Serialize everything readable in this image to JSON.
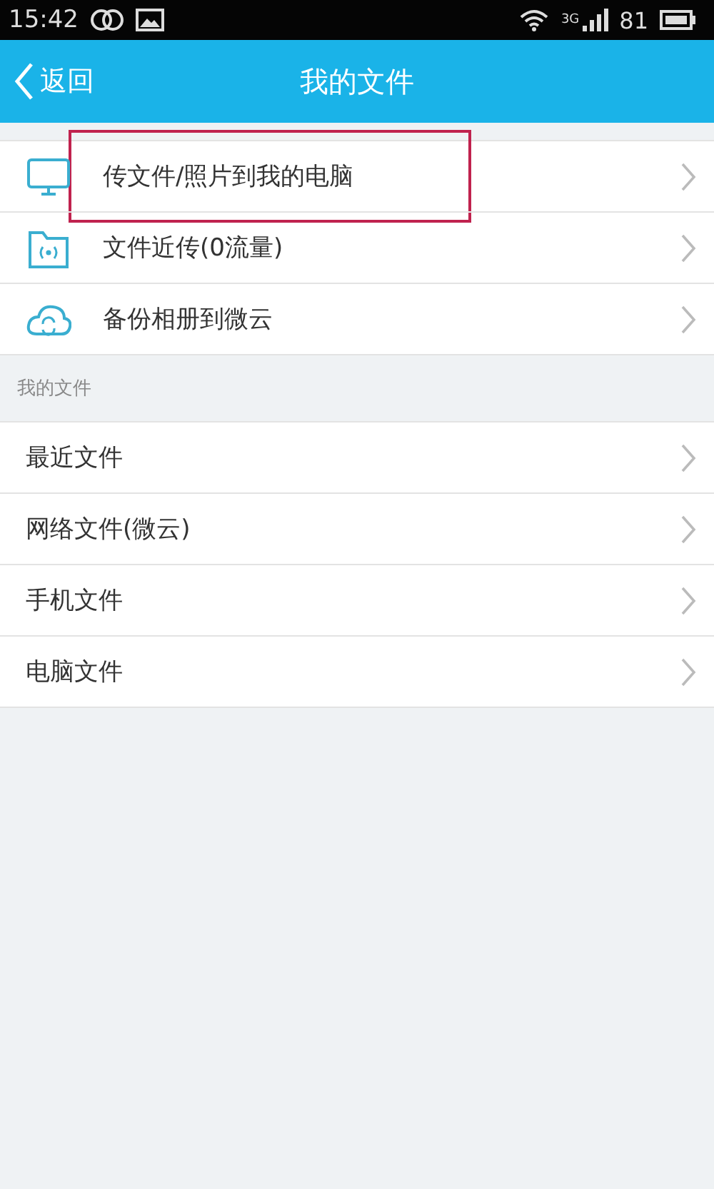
{
  "status_bar": {
    "time": "15:42",
    "network": "3G",
    "battery": "81"
  },
  "header": {
    "back": "返回",
    "title": "我的文件"
  },
  "top_items": [
    {
      "label": "传文件/照片到我的电脑",
      "highlighted": true
    },
    {
      "label": "文件近传(0流量)",
      "highlighted": false
    },
    {
      "label": "备份相册到微云",
      "highlighted": false
    }
  ],
  "section": {
    "title": "我的文件",
    "items": [
      {
        "label": "最近文件"
      },
      {
        "label": "网络文件(微云)"
      },
      {
        "label": "手机文件"
      },
      {
        "label": "电脑文件"
      }
    ]
  }
}
